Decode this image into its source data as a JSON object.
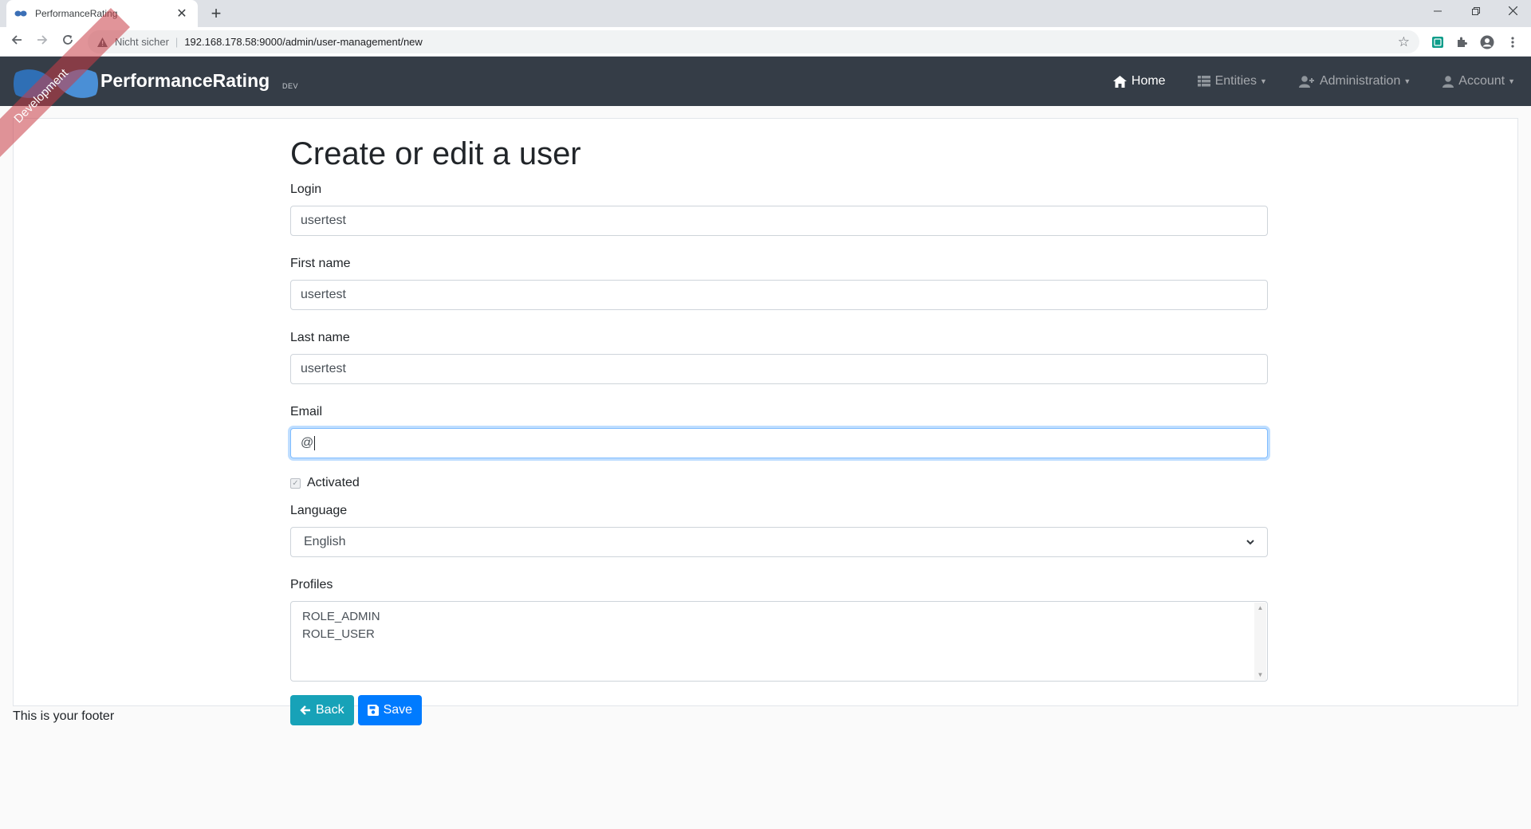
{
  "browser": {
    "tab_title": "PerformanceRating",
    "tab_close": "✕",
    "new_tab": "+",
    "security_label": "Nicht sicher",
    "url": "192.168.178.58:9000/admin/user-management/new"
  },
  "navbar": {
    "brand": "PerformanceRating",
    "env": "DEV",
    "ribbon": "Development",
    "items": [
      {
        "label": "Home",
        "icon": "home-icon",
        "active": true
      },
      {
        "label": "Entities",
        "icon": "list-icon",
        "active": false
      },
      {
        "label": "Administration",
        "icon": "user-plus-icon",
        "active": false
      },
      {
        "label": "Account",
        "icon": "user-icon",
        "active": false
      }
    ]
  },
  "form": {
    "title": "Create or edit a user",
    "login": {
      "label": "Login",
      "value": "usertest"
    },
    "first_name": {
      "label": "First name",
      "value": "usertest"
    },
    "last_name": {
      "label": "Last name",
      "value": "usertest"
    },
    "email": {
      "label": "Email",
      "value": "@"
    },
    "activated": {
      "label": "Activated",
      "checked": true
    },
    "language": {
      "label": "Language",
      "value": "English"
    },
    "profiles": {
      "label": "Profiles",
      "options": [
        "ROLE_ADMIN",
        "ROLE_USER"
      ]
    },
    "back_label": "Back",
    "save_label": "Save"
  },
  "footer": {
    "text": "This is your footer"
  },
  "colors": {
    "navbar": "#353d47",
    "back_button": "#17a2b8",
    "save_button": "#007bff",
    "ribbon": "#c83c46"
  }
}
